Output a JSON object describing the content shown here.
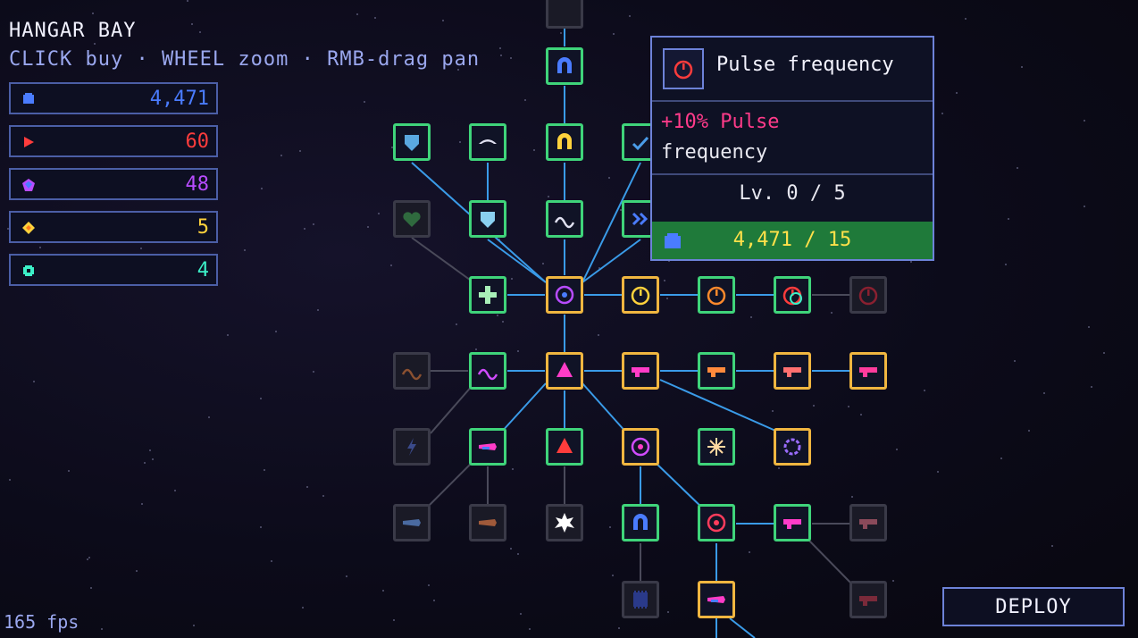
{
  "hud": {
    "title": "HANGAR BAY",
    "help": "CLICK buy · WHEEL zoom · RMB-drag pan",
    "fps": "165 fps"
  },
  "resources": [
    {
      "name": "credits",
      "value": "4,471",
      "color": "#4a7cff",
      "icon": "credit-gem-icon"
    },
    {
      "name": "red-arrow",
      "value": "60",
      "color": "#ff3c3c",
      "icon": "red-arrow-icon"
    },
    {
      "name": "purple-gem",
      "value": "48",
      "color": "#b84cff",
      "icon": "purple-gem-icon"
    },
    {
      "name": "yellow-diamond",
      "value": "5",
      "color": "#ffd23c",
      "icon": "yellow-diamond-icon"
    },
    {
      "name": "teal-gear",
      "value": "4",
      "color": "#3cf0c8",
      "icon": "teal-gear-icon"
    }
  ],
  "tooltip": {
    "name": "Pulse frequency",
    "desc_highlight": "+10% Pulse",
    "desc_rest": "frequency",
    "level": "Lv. 0 / 5",
    "cost": "4,471 / 15"
  },
  "deploy_label": "DEPLOY",
  "colors": {
    "accent_green": "#3fd47a",
    "accent_gold": "#f0b640",
    "panel_border": "#6d82d8",
    "link": "#3a9be8"
  }
}
